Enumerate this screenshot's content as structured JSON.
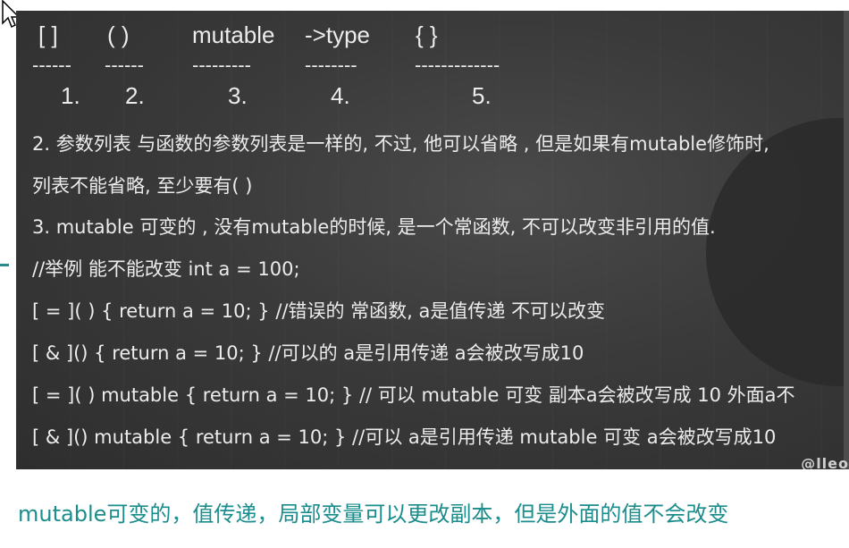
{
  "syntax": {
    "capture": "[   ]",
    "params": "(    )",
    "mutable": "mutable",
    "ret": "->type",
    "body": "{            }"
  },
  "dashes": [
    "------",
    "------",
    "---------",
    "--------",
    "-------------"
  ],
  "numbers": [
    "1.",
    "2.",
    "3.",
    "4.",
    "5."
  ],
  "lines": [
    "2. 参数列表   与函数的参数列表是一样的, 不过, 他可以省略 , 但是如果有mutable修饰时,",
    "列表不能省略, 至少要有( )",
    "3. mutable  可变的  , 没有mutable的时候, 是一个常函数, 不可以改变非引用的值.",
    "//举例  能不能改变   int  a = 100;",
    "[ = ]( ) { return a = 10; }    //错误的  常函数, a是值传递  不可以改变",
    "[ & ]() { return a = 10; }    //可以的 a是引用传递   a会被改写成10",
    "[ = ]( ) mutable { return a = 10; }   // 可以  mutable 可变  副本a会被改写成 10 外面a不",
    "[ & ]() mutable  { return a = 10; }   //可以  a是引用传递  mutable 可变  a会被改写成10"
  ],
  "caption": "mutable可变的，值传递，局部变量可以更改副本，但是外面的值不会改变",
  "watermark": "@lleo"
}
